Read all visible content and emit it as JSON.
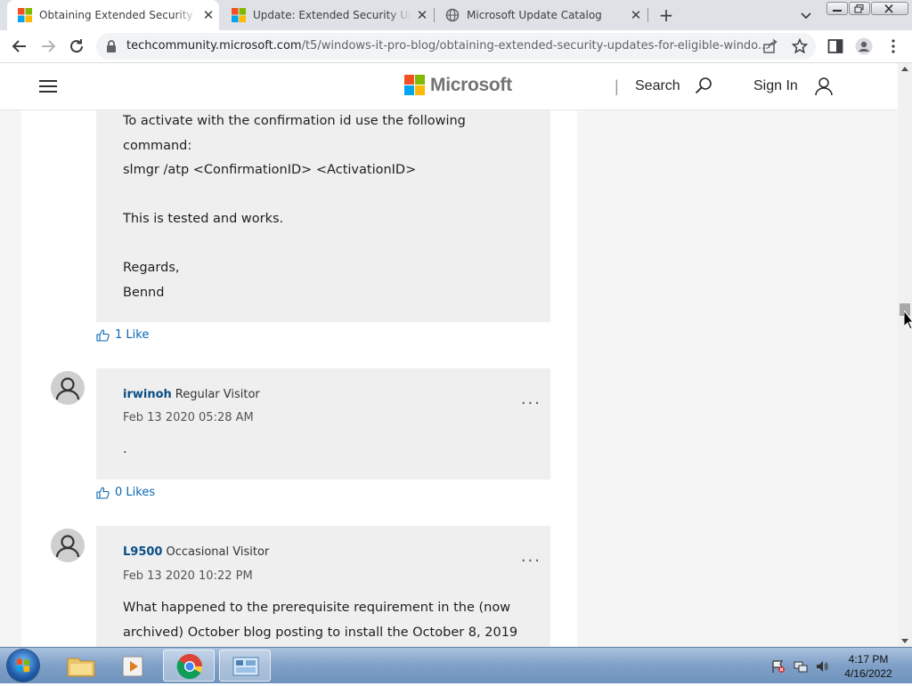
{
  "browser": {
    "tabs": [
      {
        "title": "Obtaining Extended Security Upd",
        "favicon": "microsoft-logo",
        "active": true
      },
      {
        "title": "Update: Extended Security Updat",
        "favicon": "microsoft-logo",
        "active": false
      },
      {
        "title": "Microsoft Update Catalog",
        "favicon": "globe-icon",
        "active": false
      }
    ],
    "url_host": "techcommunity.microsoft.com",
    "url_path": "/t5/windows-it-pro-blog/obtaining-extended-security-updates-for-eligible-windo..."
  },
  "site_header": {
    "brand": "Microsoft",
    "divider": "|",
    "search_label": "Search",
    "signin_label": "Sign In"
  },
  "replies": [
    {
      "body_lines": [
        "To activate with the confirmation id use the following",
        "command:",
        "slmgr /atp <ConfirmationID> <ActivationID>",
        "",
        "This is tested and works.",
        "",
        "Regards,",
        "Bennd"
      ],
      "likes": "1 Like"
    },
    {
      "author": "irwinoh",
      "rank": "Regular Visitor",
      "date": "Feb 13 2020 05:28 AM",
      "body_lines": [
        "."
      ],
      "likes": "0 Likes",
      "menu": "..."
    },
    {
      "author": "L9500",
      "rank": "Occasional Visitor",
      "date": "Feb 13 2020 10:22 PM",
      "body_lines": [
        "What happened to the prerequisite requirement in the (now",
        "archived)  October blog posting to install the October 8, 2019"
      ],
      "menu": "..."
    }
  ],
  "taskbar": {
    "apps": [
      "windows-explorer-icon",
      "media-player-icon",
      "chrome-icon",
      "control-panel-icon"
    ],
    "clock_time": "4:17 PM",
    "clock_date": "4/16/2022"
  }
}
